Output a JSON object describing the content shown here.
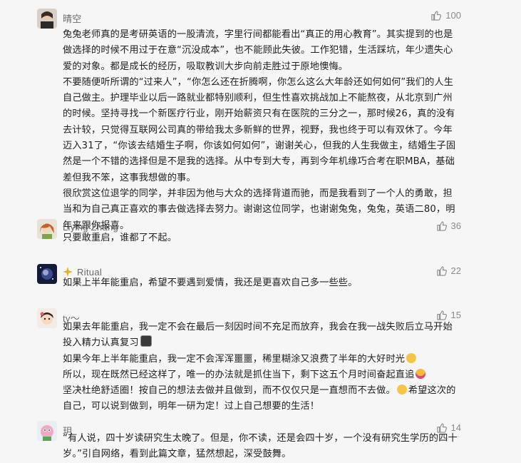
{
  "comments": [
    {
      "username": "晴空",
      "likes": "100",
      "paragraphs": [
        "兔兔老师真的是考研英语的一股清流，字里行间都能看出“真正的用心教育”。其实提到的也是做选择的时候不用过于在意“沉没成本”，也不能顾此失彼。工作犯错，生活踩坑，年少遗失心爱的对象。都是成长的经历，吸取教训大步向前走胜过于原地懊悔。",
        "不要随便听所谓的“过来人”，“你怎么还在折腾啊，你怎么这么大年龄还如何如何”我们的人生自己做主。护理毕业以后一路就业都特别顺利，但生性喜欢挑战加上不能熬夜，从北京到广州的时候。坚持寻找一个新医疗行业，刚开始薪资只有在医院的三分之一，那时候26，真的没有去计较，只觉得互联网公司真的带给我太多新鲜的世界，视野，我也终于可以有双休了。今年迈入31了，“你该去结婚生子啊，你该如何如何”，谢谢关心，但我的人生我做主，结婚生子固然是一个不错的选择但是不是我的选择。从中专到大专，再到今年机缘巧合考在职MBA，基础差但我不笨，这事我想做的事。",
        "很欣赏这位退学的同学，并非因为他与大众的选择背道而驰，而是我看到了一个人的勇敢，担当和为自己真正喜欢的事去做选择去努力。谢谢这位同学，也谢谢兔兔，兔兔，英语二80，明年来跟你报喜。"
      ]
    },
    {
      "username": "Liying Zhang",
      "likes": "36",
      "paragraphs": [
        "只要敢重启，谁都了不起。"
      ]
    },
    {
      "username": "Ritual",
      "likes": "22",
      "paragraphs": [
        "如果上半年能重启，希望不要遇到爱情，我还是更喜欢自己多一些些。"
      ]
    },
    {
      "username": "ty～",
      "likes": "15",
      "p1": "如果去年能重启，我一定不会在最后一刻因时间不充足而放弃，我会在我一战失败后立马开始投入精力认真复习",
      "p2a": "如果今年上半年能重启，我一定不会浑浑噩噩，稀里糊涂又浪费了半年的大好时光",
      "p2b": "所以，现在既然已经这样了，唯一的办法就是抓住当下，剩下这五个月时间奋起直追",
      "p2c": "坚决杜绝舒适圈！按自己的想法去做并且做到，而不仅仅只是一直想而不去做。",
      "p2d": "希望这次的自己，可以说到做到，明年一研为定！过上自己想要的生活！"
    },
    {
      "username": "玥",
      "likes": "14",
      "paragraphs": [
        "“有人说，四十岁读研究生太晚了。但是，你不读，还是会四十岁，一个没有研究生学历的四十岁。”引自网络，看到此篇文章，猛然想起，深受鼓舞。"
      ]
    }
  ],
  "icons": {
    "like": "thumbs-up-icon",
    "ritual_badge": "sparkle-badge-icon"
  },
  "colors": {
    "background": "#f6f6f6",
    "username": "#6a6a6a",
    "like": "#8a8a8a",
    "text": "#1f1f1f"
  }
}
